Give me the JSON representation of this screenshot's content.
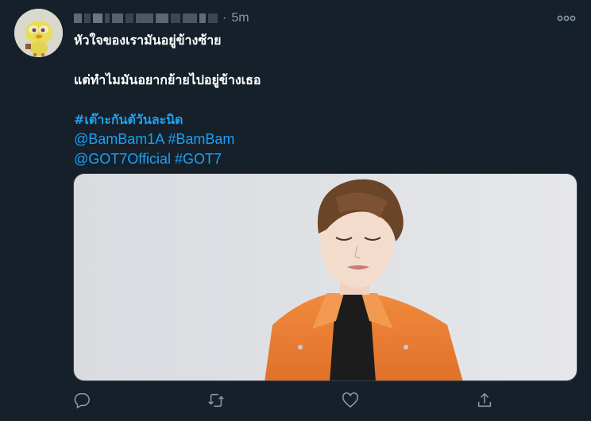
{
  "tweet": {
    "author_name_blurred": true,
    "separator": "·",
    "timestamp": "5m",
    "lines": [
      "หัวใจของเรามันอยู่ข้างซ้าย",
      "แต่ทำไมมันอยากย้ายไปอยู่ข้างเธอ"
    ],
    "hashtag_thai": "#เต๊าะกันตัวันละนิด",
    "mentions_line1": "@BamBam1A #BamBam",
    "mentions_line2": "@GOT7Official #GOT7"
  },
  "icons": {
    "more": "more-horizontal-icon",
    "reply": "reply-icon",
    "retweet": "retweet-icon",
    "like": "heart-icon",
    "share": "share-icon"
  },
  "colors": {
    "background": "#15202b",
    "text": "#ffffff",
    "secondary": "#8899a6",
    "link": "#1da1f2",
    "border": "#38444d"
  }
}
